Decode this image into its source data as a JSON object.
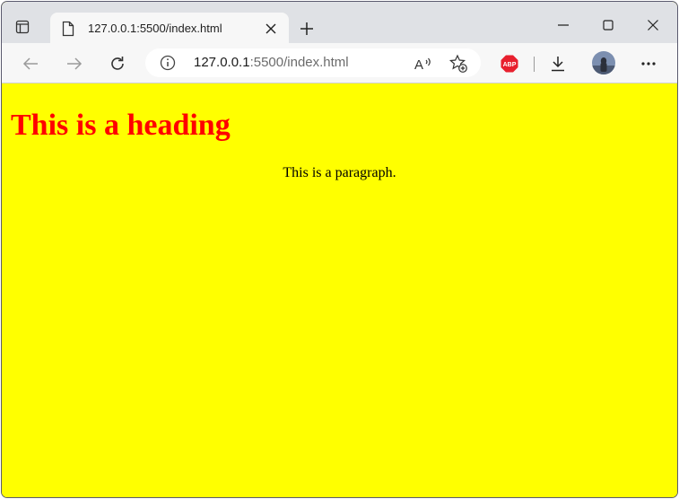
{
  "browser": {
    "tab": {
      "title": "127.0.0.1:5500/index.html"
    },
    "address_bar": {
      "host": "127.0.0.1",
      "rest": ":5500/index.html"
    },
    "extension_badge": "ABP",
    "colors": {
      "titlebar": "#dfe1e5",
      "toolbar": "#f7f7f7"
    }
  },
  "page": {
    "heading": "This is a heading",
    "paragraph": "This is a paragraph.",
    "colors": {
      "background": "#ffff00",
      "heading": "#ff0000",
      "text": "#000000"
    }
  }
}
